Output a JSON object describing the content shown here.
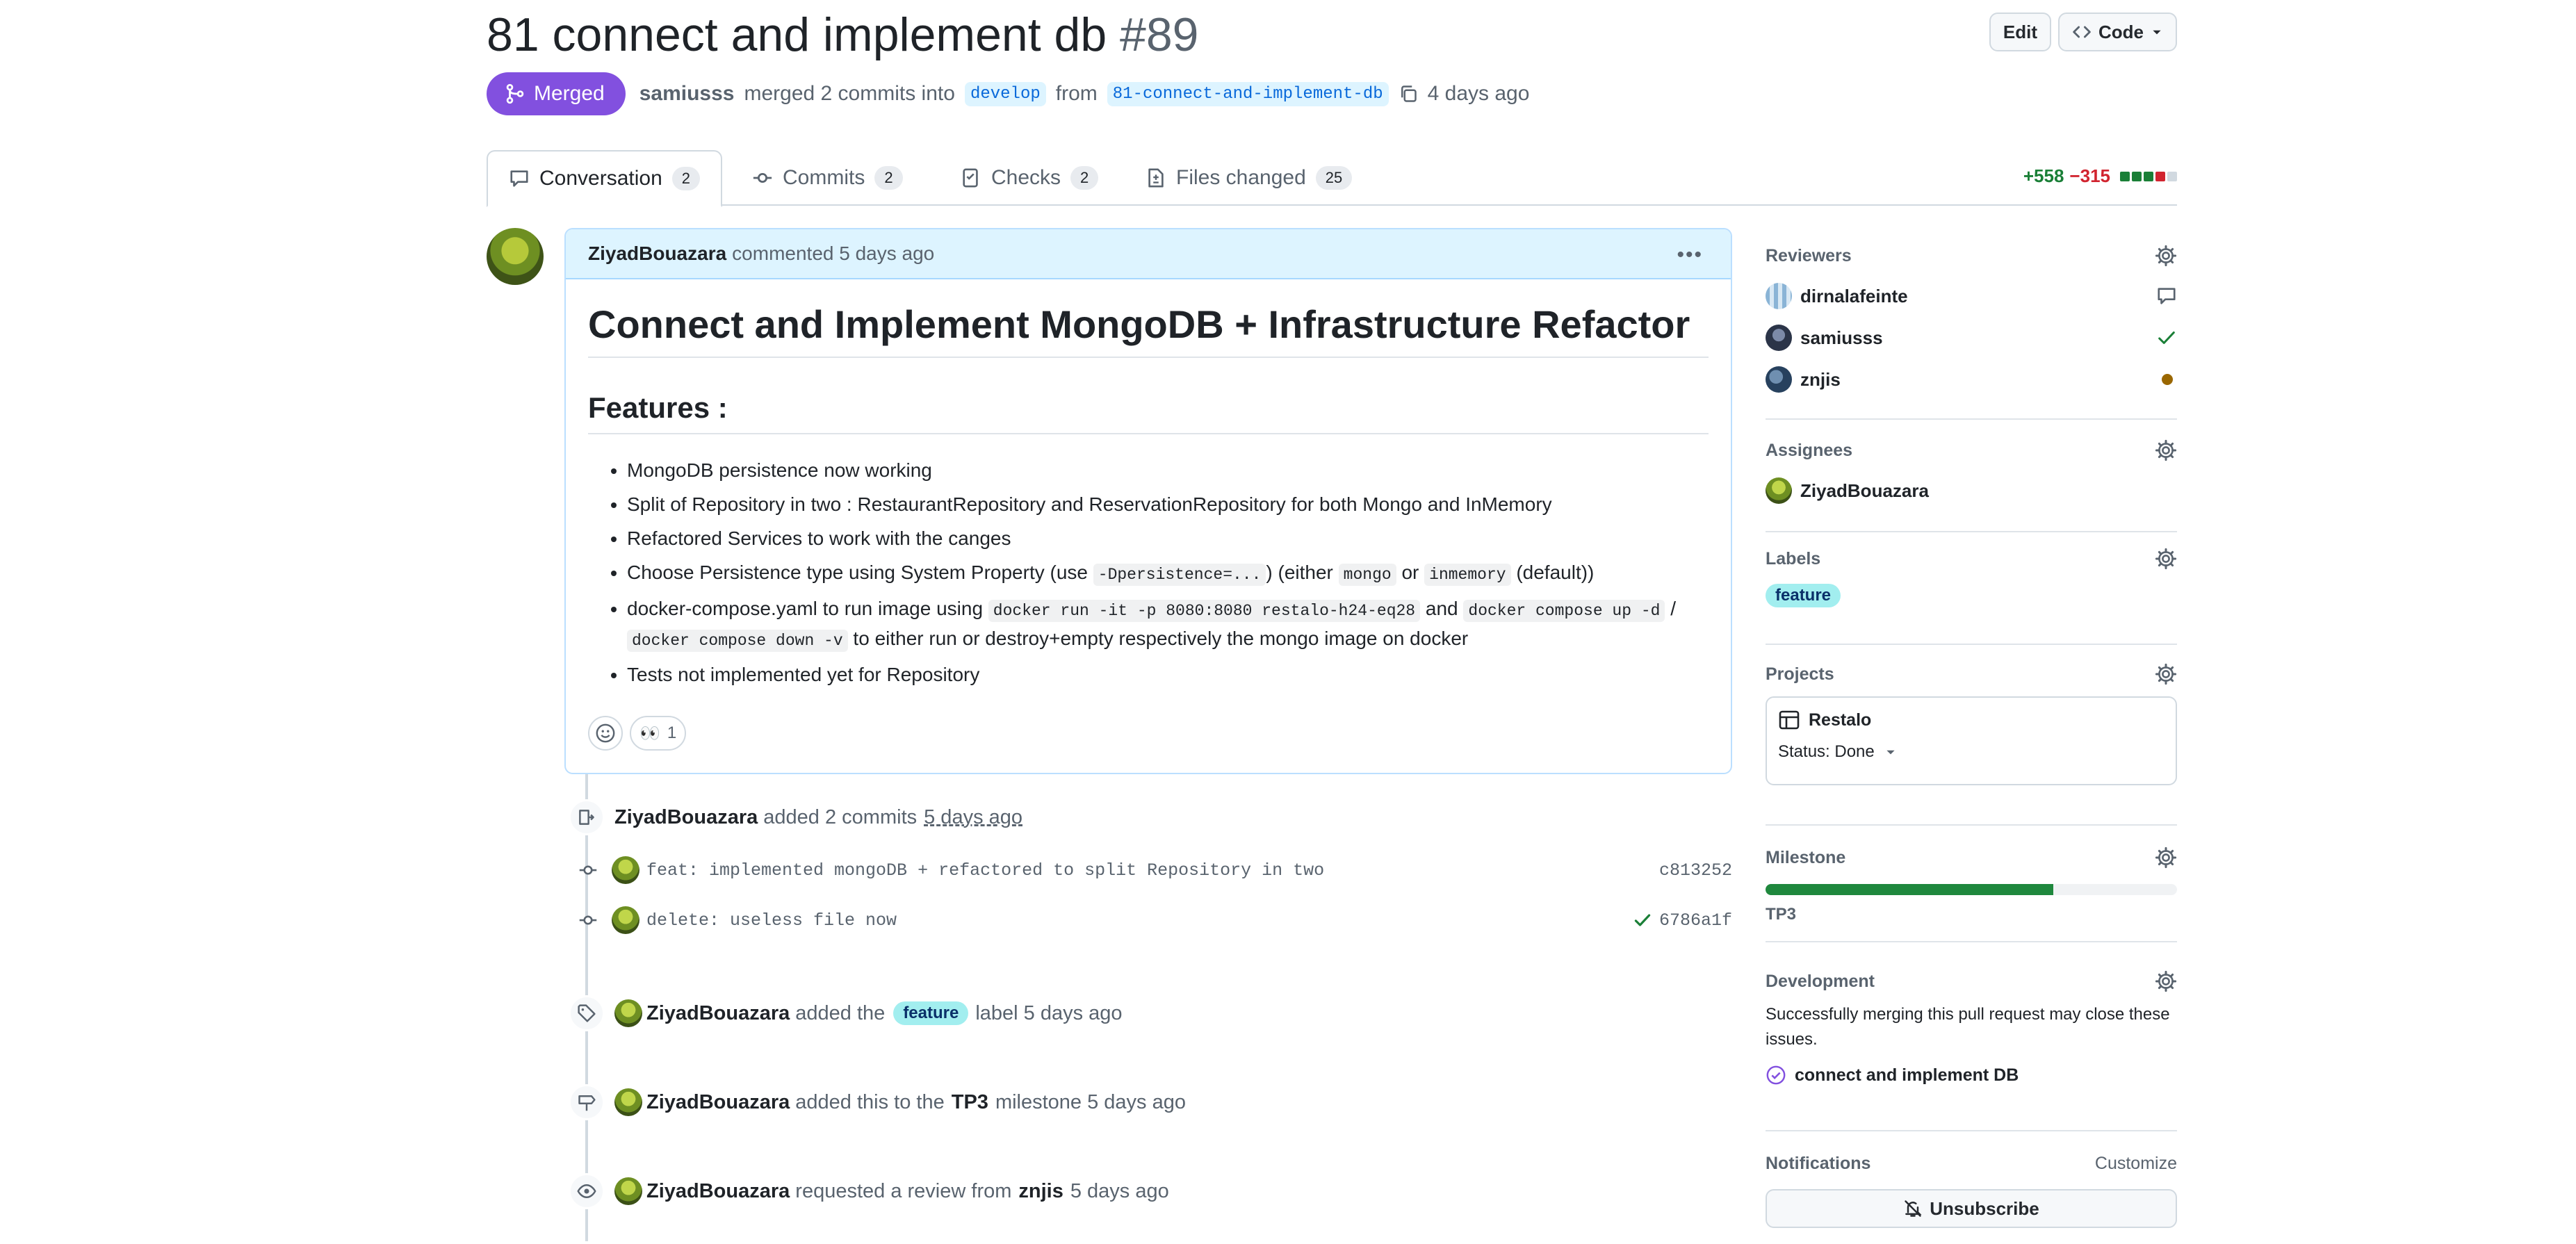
{
  "header": {
    "title": "81 connect and implement db",
    "number": "#89",
    "edit_label": "Edit",
    "code_label": "Code",
    "status": "Merged",
    "author": "samiusss",
    "merge_text": "merged 2 commits into",
    "base_branch": "develop",
    "from_text": "from",
    "head_branch": "81-connect-and-implement-db",
    "time": "4 days ago"
  },
  "tabs": [
    {
      "label": "Conversation",
      "count": "2"
    },
    {
      "label": "Commits",
      "count": "2"
    },
    {
      "label": "Checks",
      "count": "2"
    },
    {
      "label": "Files changed",
      "count": "25"
    }
  ],
  "diffstat": {
    "additions": "+558",
    "deletions": "−315",
    "colors": [
      "#1a7f37",
      "#1a7f37",
      "#1a7f37",
      "#d1242f",
      "#d1d9e0"
    ]
  },
  "comment": {
    "author": "ZiyadBouazara",
    "meta": "commented 5 days ago",
    "h1": "Connect and Implement MongoDB + Infrastructure Refactor",
    "h2": "Features :",
    "items": {
      "i1": "MongoDB persistence now working",
      "i2": "Split of Repository in two : RestaurantRepository and ReservationRepository for both Mongo and InMemory",
      "i3": "Refactored Services to work with the canges",
      "i4_a": "Choose Persistence type using System Property (use ",
      "i4_code1": "-Dpersistence=...",
      "i4_b": ") (either ",
      "i4_code2": "mongo",
      "i4_c": " or ",
      "i4_code3": "inmemory",
      "i4_d": " (default))",
      "i5_a": "docker-compose.yaml to run image using ",
      "i5_code1": "docker run -it -p 8080:8080 restalo-h24-eq28",
      "i5_b": " and ",
      "i5_code2": "docker compose up -d",
      "i5_c": " / ",
      "i5_code3": "docker compose down -v",
      "i5_d": " to either run or destroy+empty respectively the mongo image on docker",
      "i6": "Tests not implemented yet for Repository"
    },
    "reaction_emoji": "👀",
    "reaction_count": "1"
  },
  "timeline": {
    "commits_event": {
      "author": "ZiyadBouazara",
      "text": "added 2 commits",
      "time": "5 days ago"
    },
    "commits": [
      {
        "message": "feat: implemented mongoDB + refactored to split Repository in two",
        "sha": "c813252"
      },
      {
        "message": "delete: useless file now",
        "sha": "6786a1f"
      }
    ],
    "label_event": {
      "author": "ZiyadBouazara",
      "pre": "added the",
      "label": "feature",
      "post": "label 5 days ago"
    },
    "milestone_event": {
      "author": "ZiyadBouazara",
      "pre": "added this to the",
      "milestone": "TP3",
      "post": "milestone 5 days ago"
    },
    "review_event": {
      "author": "ZiyadBouazara",
      "pre": "requested a review from",
      "reviewer": "znjis",
      "post": "5 days ago"
    }
  },
  "sidebar": {
    "reviewers": {
      "title": "Reviewers",
      "list": [
        {
          "name": "dirnalafeinte",
          "state": "comment-icon"
        },
        {
          "name": "samiusss",
          "state": "check-icon"
        },
        {
          "name": "znjis",
          "state": "pending-dot-icon"
        }
      ]
    },
    "assignees": {
      "title": "Assignees",
      "name": "ZiyadBouazara"
    },
    "labels": {
      "title": "Labels",
      "label": "feature"
    },
    "projects": {
      "title": "Projects",
      "name": "Restalo",
      "status": "Status: Done"
    },
    "milestone": {
      "title": "Milestone",
      "name": "TP3",
      "progress": 0.7
    },
    "development": {
      "title": "Development",
      "text": "Successfully merging this pull request may close these issues.",
      "issue": "connect and implement DB"
    },
    "notifications": {
      "title": "Notifications",
      "customize": "Customize",
      "unsubscribe": "Unsubscribe"
    }
  }
}
